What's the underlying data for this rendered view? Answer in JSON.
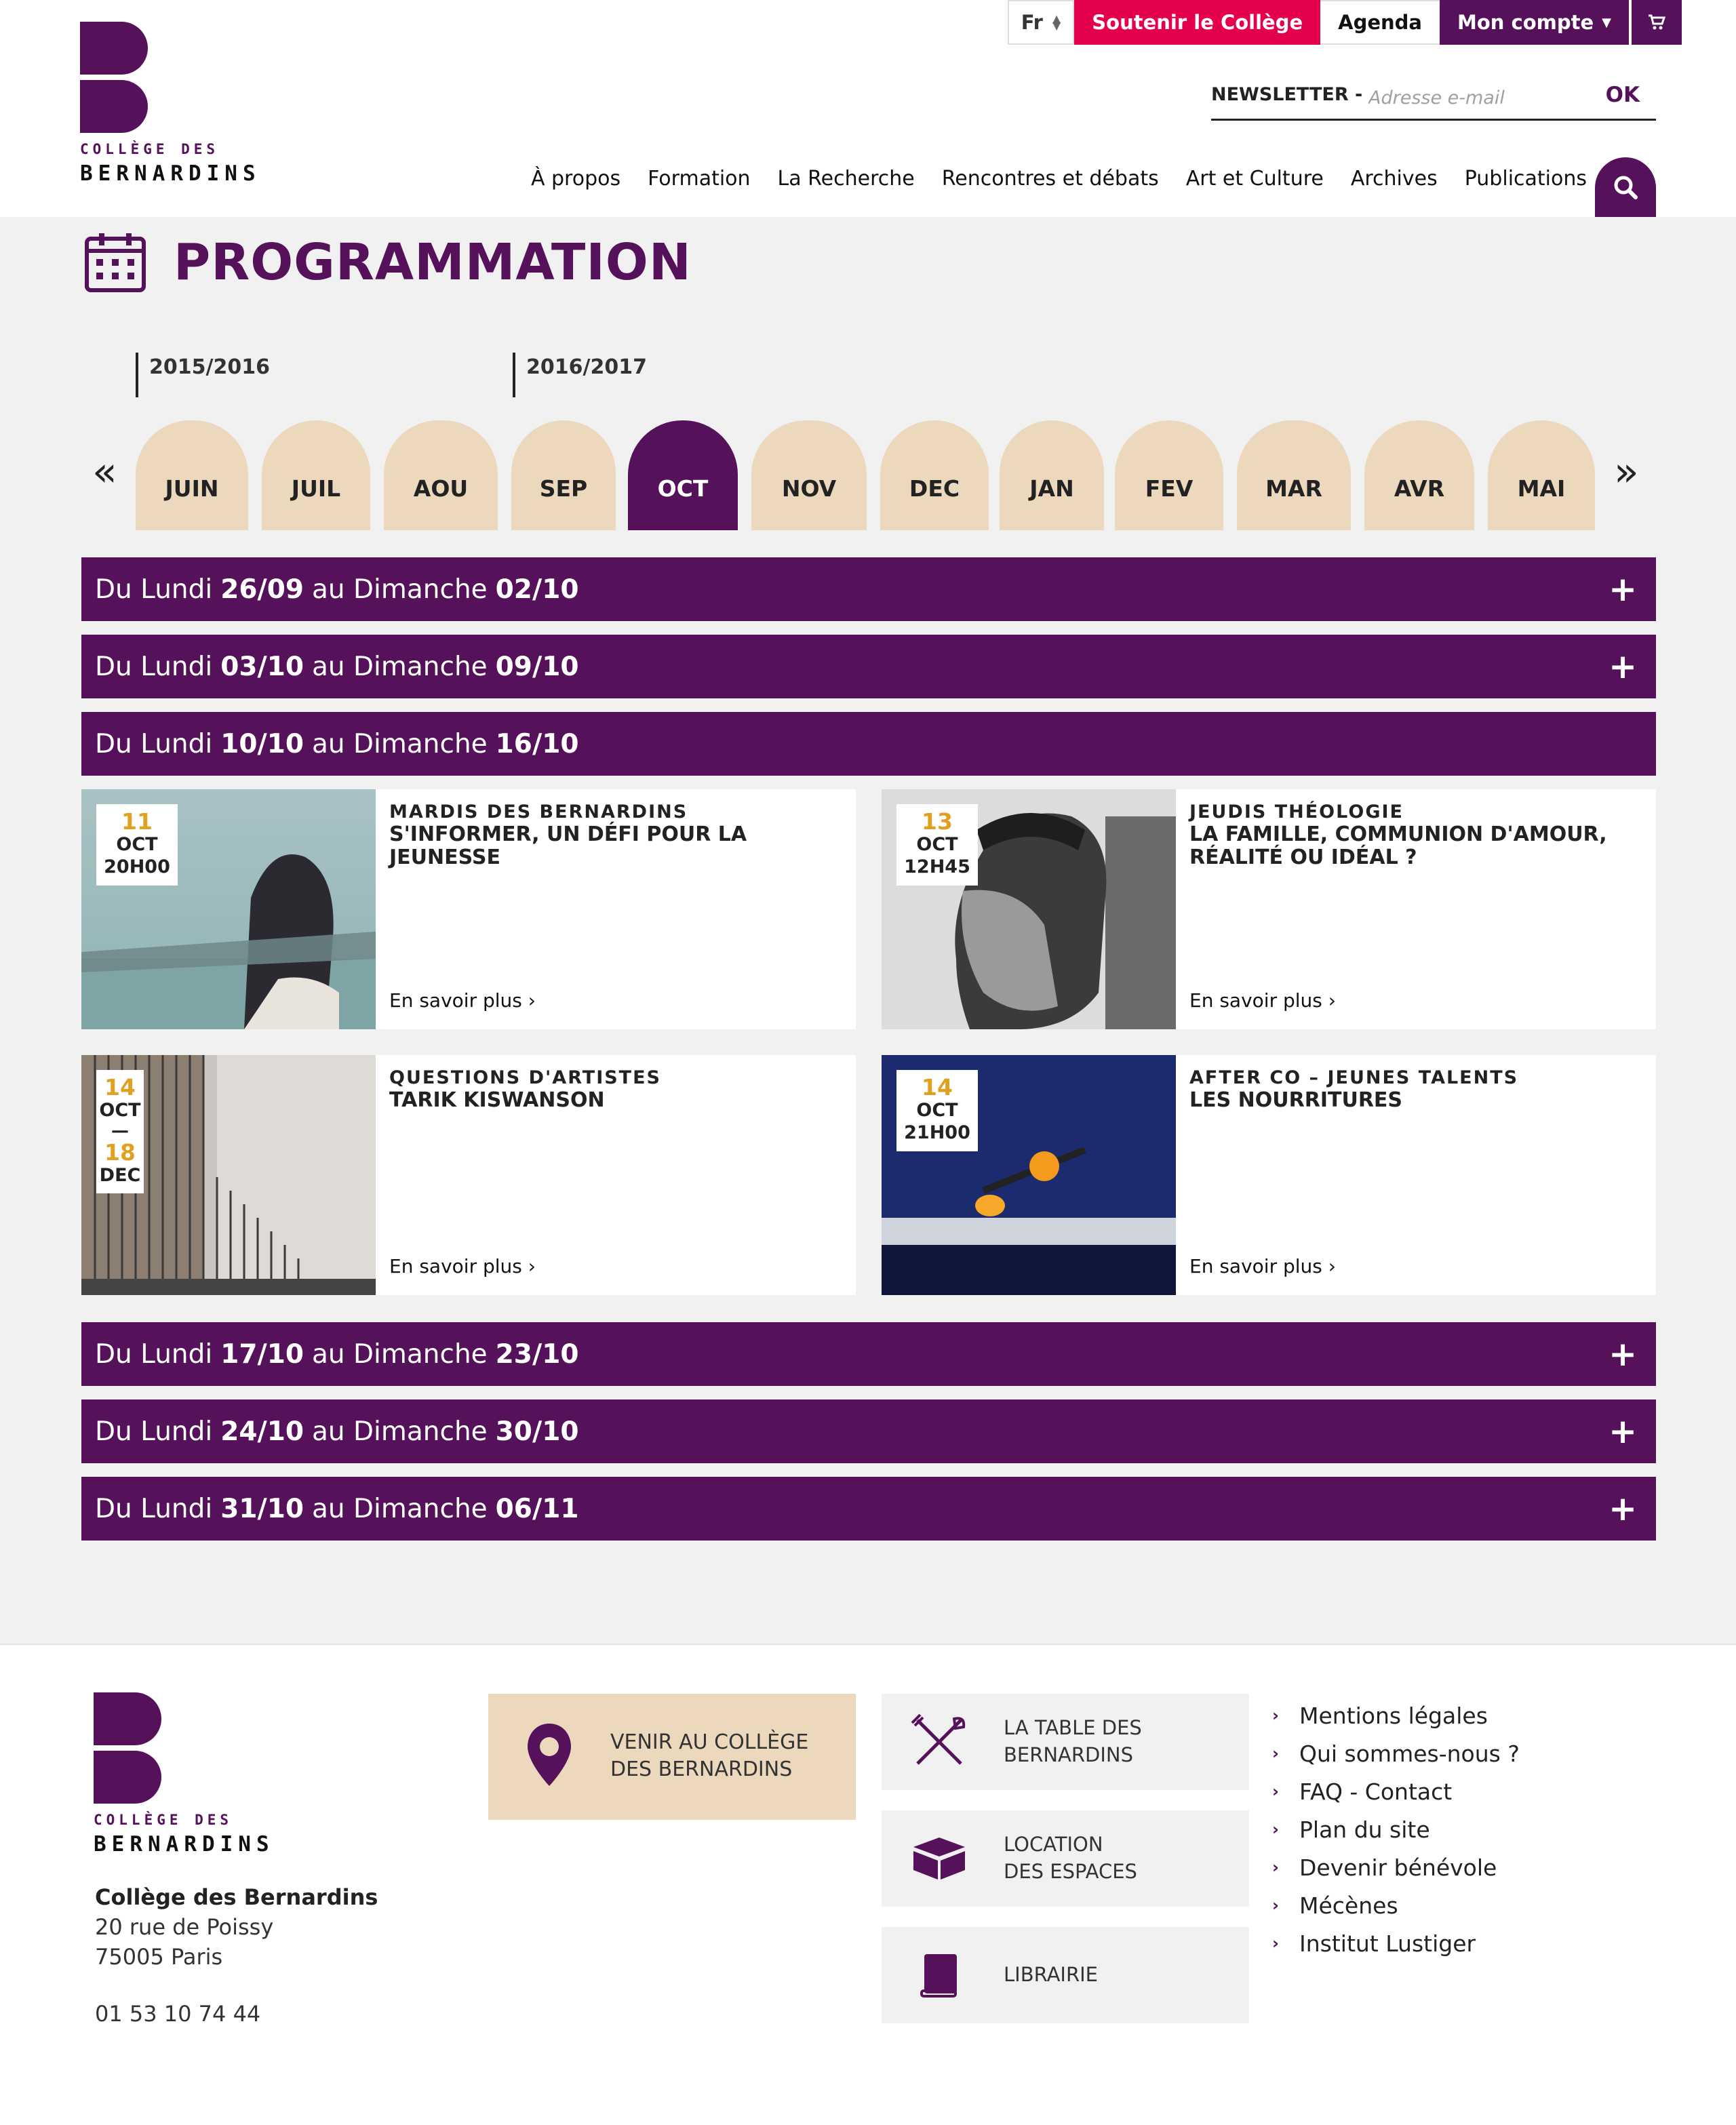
{
  "brand": {
    "line1": "COLLÈGE DES",
    "line2": "BERNARDINS",
    "color": "#55115a"
  },
  "topbar": {
    "lang": "Fr",
    "support": "Soutenir le Collège",
    "agenda": "Agenda",
    "account": "Mon compte",
    "cart_icon": "cart-icon"
  },
  "newsletter": {
    "label": "NEWSLETTER -",
    "placeholder": "Adresse e-mail",
    "ok": "OK"
  },
  "nav": [
    "À propos",
    "Formation",
    "La Recherche",
    "Rencontres et débats",
    "Art et Culture",
    "Archives",
    "Publications"
  ],
  "page_title": "PROGRAMMATION",
  "seasons": [
    "2015/2016",
    "2016/2017"
  ],
  "months": [
    "JUIN",
    "JUIL",
    "AOU",
    "SEP",
    "OCT",
    "NOV",
    "DEC",
    "JAN",
    "FEV",
    "MAR",
    "AVR",
    "MAI"
  ],
  "active_month": "OCT",
  "weeks": [
    {
      "prefix": "Du Lundi",
      "from": "26/09",
      "mid": "au Dimanche",
      "to": "02/10",
      "expanded": false
    },
    {
      "prefix": "Du Lundi",
      "from": "03/10",
      "mid": "au Dimanche",
      "to": "09/10",
      "expanded": false
    },
    {
      "prefix": "Du Lundi",
      "from": "10/10",
      "mid": "au Dimanche",
      "to": "16/10",
      "expanded": true
    },
    {
      "prefix": "Du Lundi",
      "from": "17/10",
      "mid": "au Dimanche",
      "to": "23/10",
      "expanded": false
    },
    {
      "prefix": "Du Lundi",
      "from": "24/10",
      "mid": "au Dimanche",
      "to": "30/10",
      "expanded": false
    },
    {
      "prefix": "Du Lundi",
      "from": "31/10",
      "mid": "au Dimanche",
      "to": "06/11",
      "expanded": false
    }
  ],
  "events": [
    {
      "day": "11",
      "month": "OCT",
      "time": "20H00",
      "series": "MARDIS DES BERNARDINS",
      "title": "S'INFORMER, UN DÉFI POUR LA JEUNESSE",
      "more": "En savoir plus"
    },
    {
      "day": "13",
      "month": "OCT",
      "time": "12H45",
      "series": "JEUDIS THÉOLOGIE",
      "title": "LA FAMILLE, COMMUNION D'AMOUR, RÉALITÉ OU IDÉAL ?",
      "more": "En savoir plus"
    },
    {
      "day": "14",
      "month": "OCT",
      "end_day": "18",
      "end_month": "DEC",
      "series": "QUESTIONS D'ARTISTES",
      "title": "TARIK KISWANSON",
      "more": "En savoir plus"
    },
    {
      "day": "14",
      "month": "OCT",
      "time": "21H00",
      "series": "AFTER CO – JEUNES TALENTS",
      "title": "LES NOURRITURES",
      "more": "En savoir plus"
    }
  ],
  "footer": {
    "name": "Collège des Bernardins",
    "street": "20 rue de Poissy",
    "city": "75005 Paris",
    "phone": "01 53 10 74 44",
    "venir": [
      "VENIR AU COLLÈGE",
      "DES BERNARDINS"
    ],
    "table": [
      "LA TABLE DES",
      "BERNARDINS"
    ],
    "location": [
      "LOCATION",
      "DES ESPACES"
    ],
    "librairie": "LIBRAIRIE",
    "links": [
      "Mentions légales",
      "Qui sommes-nous ?",
      "FAQ - Contact",
      "Plan du site",
      "Devenir bénévole",
      "Mécènes",
      "Institut Lustiger"
    ]
  }
}
